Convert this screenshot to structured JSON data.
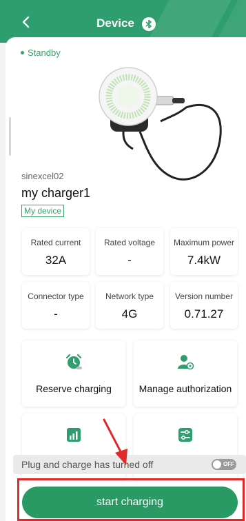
{
  "header": {
    "title": "Device"
  },
  "device": {
    "status": "Standby",
    "model": "sinexcel02",
    "name": "my charger1",
    "tag": "My device"
  },
  "specs": [
    {
      "label": "Rated current",
      "value": "32A"
    },
    {
      "label": "Rated voltage",
      "value": "-"
    },
    {
      "label": "Maximum power",
      "value": "7.4kW"
    },
    {
      "label": "Connector type",
      "value": "-"
    },
    {
      "label": "Network type",
      "value": "4G"
    },
    {
      "label": "Version number",
      "value": "0.71.27"
    }
  ],
  "actions": [
    {
      "label": "Reserve charging",
      "icon": "alarm-clock-icon"
    },
    {
      "label": "Manage authorization",
      "icon": "user-settings-icon"
    },
    {
      "label": "",
      "icon": "chart-icon"
    },
    {
      "label": "",
      "icon": "sliders-icon"
    }
  ],
  "notice": {
    "text": "Plug and charge has turned off",
    "toggle_text": "OFF"
  },
  "primary_button": {
    "label": "start charging"
  },
  "colors": {
    "brand": "#2e9e6e",
    "button": "#2a9a64",
    "annotation": "#e02a2a"
  }
}
